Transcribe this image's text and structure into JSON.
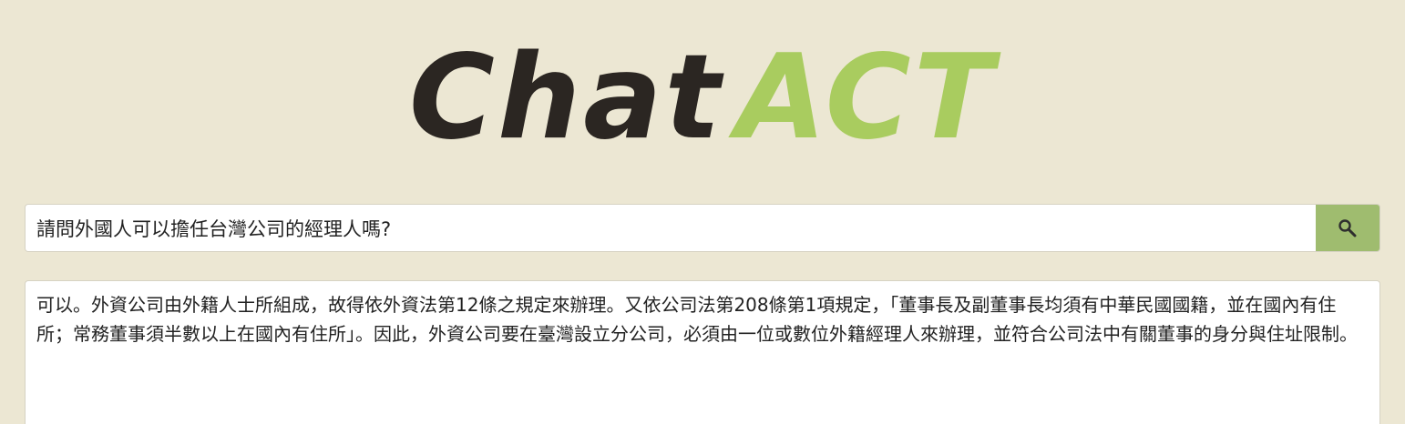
{
  "logo": {
    "part1": "Chat",
    "part2": "ACT"
  },
  "search": {
    "value": "請問外國人可以擔任台灣公司的經理人嗎?",
    "button_icon": "search-icon"
  },
  "answer": {
    "text": "可以。外資公司由外籍人士所組成，故得依外資法第12條之規定來辦理。又依公司法第208條第1項規定，「董事長及副董事長均須有中華民國國籍，並在國內有住所；常務董事須半數以上在國內有住所」。因此，外資公司要在臺灣設立分公司，必須由一位或數位外籍經理人來辦理，並符合公司法中有關董事的身分與住址限制。"
  },
  "colors": {
    "background": "#ece7d3",
    "logo_dark": "#2b2622",
    "logo_green": "#a9cc5f",
    "button_green": "#9fbc6f"
  }
}
